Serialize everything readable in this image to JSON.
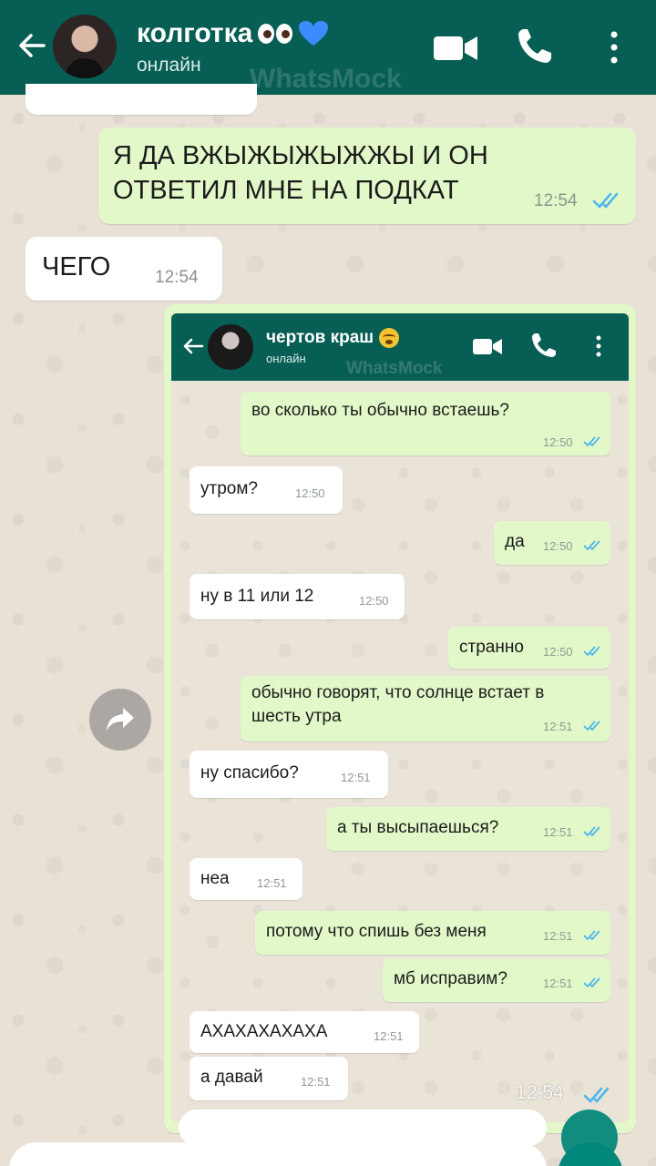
{
  "header": {
    "title": "колготка",
    "status": "онлайн",
    "watermark": "WhatsMock"
  },
  "messages": [
    {
      "dir": "out",
      "lines": [
        "Я ДА ВЖЫЖЫЖЫЖЖЫ И ОН",
        "ОТВЕТИЛ МНЕ НА ПОДКАТ"
      ],
      "time": "12:54",
      "read": true
    },
    {
      "dir": "in",
      "text": "ЧЕГО",
      "time": "12:54"
    }
  ],
  "screenshot": {
    "header": {
      "title": "чертов краш",
      "status": "онлайн",
      "watermark": "WhatsMock"
    },
    "messages": [
      {
        "dir": "out",
        "text": "во сколько ты обычно встаешь?",
        "time": "12:50"
      },
      {
        "dir": "in",
        "text": "утром?",
        "time": "12:50"
      },
      {
        "dir": "out",
        "text": "да",
        "time": "12:50"
      },
      {
        "dir": "in",
        "text": "ну в 11 или 12",
        "time": "12:50"
      },
      {
        "dir": "out",
        "text": "странно",
        "time": "12:50"
      },
      {
        "dir": "out",
        "lines": [
          "обычно говорят, что солнце встает в",
          "шесть утра"
        ],
        "time": "12:51"
      },
      {
        "dir": "in",
        "text": "ну спасибо?",
        "time": "12:51"
      },
      {
        "dir": "out",
        "text": "а ты высыпаешься?",
        "time": "12:51"
      },
      {
        "dir": "in",
        "text": "неа",
        "time": "12:51"
      },
      {
        "dir": "out",
        "text": "потому что спишь без меня",
        "time": "12:51"
      },
      {
        "dir": "out",
        "text": "мб исправим?",
        "time": "12:51"
      },
      {
        "dir": "in",
        "text": "АХАХАХАХАХА",
        "time": "12:51"
      },
      {
        "dir": "in",
        "text": "а давай",
        "time": "12:51"
      }
    ],
    "bubble_time": "12:54"
  },
  "colors": {
    "header": "#075e54",
    "outgoing": "#e2f8c9",
    "incoming": "#ffffff",
    "tick_blue": "#4fb6ec"
  },
  "icons": [
    "back-arrow-icon",
    "video-call-icon",
    "phone-icon",
    "menu-icon",
    "forward-icon",
    "double-tick-icon",
    "blue-heart-icon",
    "eyes-icon",
    "weary-face-icon"
  ]
}
